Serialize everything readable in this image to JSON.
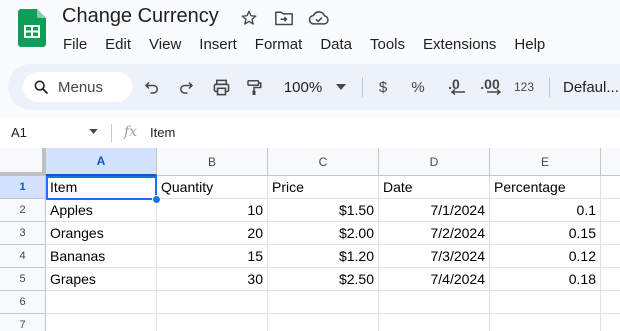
{
  "document": {
    "title": "Change Currency"
  },
  "menu": [
    "File",
    "Edit",
    "View",
    "Insert",
    "Format",
    "Data",
    "Tools",
    "Extensions",
    "Help"
  ],
  "toolbar": {
    "search_label": "Menus",
    "zoom": "100%",
    "currency_symbol": "$",
    "percent_symbol": "%",
    "decrease_decimal": ".0",
    "increase_decimal": ".00",
    "more_formats": "123",
    "font": "Defaul..."
  },
  "formula_bar": {
    "cell_ref": "A1",
    "fx": "fx",
    "content": "Item"
  },
  "grid": {
    "columns": [
      "A",
      "B",
      "C",
      "D",
      "E"
    ],
    "row_numbers": [
      "1",
      "2",
      "3",
      "4",
      "5",
      "6",
      "7"
    ],
    "rows": [
      [
        "Item",
        "Quantity",
        "Price",
        "Date",
        "Percentage"
      ],
      [
        "Apples",
        "10",
        "$1.50",
        "7/1/2024",
        "0.1"
      ],
      [
        "Oranges",
        "20",
        "$2.00",
        "7/2/2024",
        "0.15"
      ],
      [
        "Bananas",
        "15",
        "$1.20",
        "7/3/2024",
        "0.12"
      ],
      [
        "Grapes",
        "30",
        "$2.50",
        "7/4/2024",
        "0.18"
      ],
      [
        "",
        "",
        "",
        "",
        ""
      ],
      [
        "",
        "",
        "",
        "",
        ""
      ]
    ]
  },
  "colors": {
    "accent": "#0b57d0",
    "selection": "#1a73e8",
    "sheets_green": "#0f9d58",
    "toolbar_bg": "#edf2fa"
  }
}
